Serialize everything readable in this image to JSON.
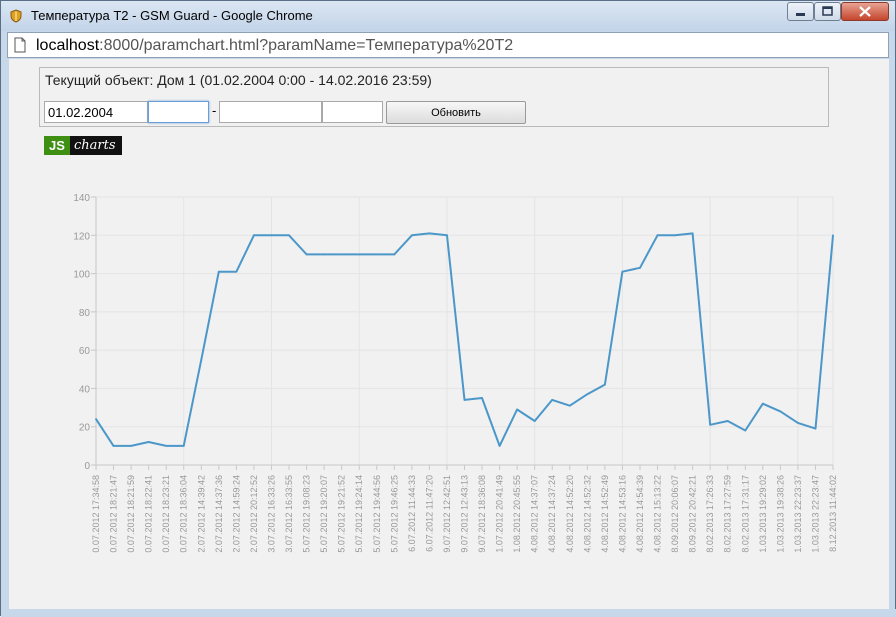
{
  "window": {
    "title": "Температура Т2 - GSM Guard - Google Chrome",
    "icons": {
      "app": "shield-icon",
      "minimize": "minimize-icon",
      "maximize": "maximize-icon",
      "close": "close-icon"
    }
  },
  "address_bar": {
    "host": "localhost",
    "path": ":8000/paramchart.html?paramName=Температура%20Т2",
    "icon": "page-icon"
  },
  "form": {
    "title": "Текущий объект: Дом 1 (01.02.2004 0:00 - 14.02.2016 23:59)",
    "date_from": "01.02.2004",
    "time_from": "",
    "date_to": "",
    "time_to": "",
    "separator": "-",
    "refresh_label": "Обновить"
  },
  "logo": {
    "js": "JS",
    "charts": "charts"
  },
  "colors": {
    "line": "#4b97c9",
    "grid": "#e4e4e4",
    "axis": "#c8c8c8",
    "label": "#999999"
  },
  "chart_data": {
    "type": "line",
    "title": "",
    "xlabel": "",
    "ylabel": "",
    "ylim": [
      0,
      140
    ],
    "yticks": [
      0,
      20,
      40,
      60,
      80,
      100,
      120,
      140
    ],
    "grid": true,
    "x": [
      "0.07.2012 17:34:58",
      "0.07.2012 18:21:47",
      "0.07.2012 18:21:59",
      "0.07.2012 18:22:41",
      "0.07.2012 18:23:21",
      "0.07.2012 18:36:04",
      "2.07.2012 14:39:42",
      "2.07.2012 14:37:36",
      "2.07.2012 14:59:24",
      "2.07.2012 20:12:52",
      "3.07.2012 16:33:26",
      "3.07.2012 16:33:55",
      "5.07.2012 19:08:23",
      "5.07.2012 19:20:07",
      "5.07.2012 19:21:52",
      "5.07.2012 19:24:14",
      "5.07.2012 19:44:56",
      "5.07.2012 19:46:25",
      "6.07.2012 11:44:33",
      "6.07.2012 11:47:20",
      "9.07.2012 12:42:51",
      "9.07.2012 12:43:13",
      "9.07.2012 18:36:08",
      "1.07.2012 20:41:49",
      "1.08.2012 20:45:55",
      "4.08.2012 14:37:07",
      "4.08.2012 14:37:24",
      "4.08.2012 14:52:20",
      "4.08.2012 14:52:32",
      "4.08.2012 14:52:49",
      "4.08.2012 14:53:16",
      "4.08.2012 14:54:39",
      "4.08.2012 15:13:22",
      "8.09.2012 20:06:07",
      "8.09.2012 20:42:21",
      "8.02.2013 17:26:33",
      "8.02.2013 17:27:59",
      "8.02.2013 17:31:17",
      "1.03.2013 19:29:02",
      "1.03.2013 19:38:26",
      "1.03.2013 22:23:37",
      "1.03.2013 22:23:47",
      "8.12.2013 11:44:02"
    ],
    "series": [
      {
        "values": [
          24,
          10,
          10,
          12,
          10,
          10,
          55,
          101,
          101,
          120,
          120,
          120,
          110,
          110,
          110,
          110,
          110,
          110,
          120,
          121,
          120,
          34,
          35,
          10,
          29,
          23,
          34,
          31,
          37,
          42,
          101,
          103,
          120,
          120,
          121,
          21,
          23,
          18,
          32,
          28,
          22,
          19,
          120
        ]
      }
    ]
  }
}
